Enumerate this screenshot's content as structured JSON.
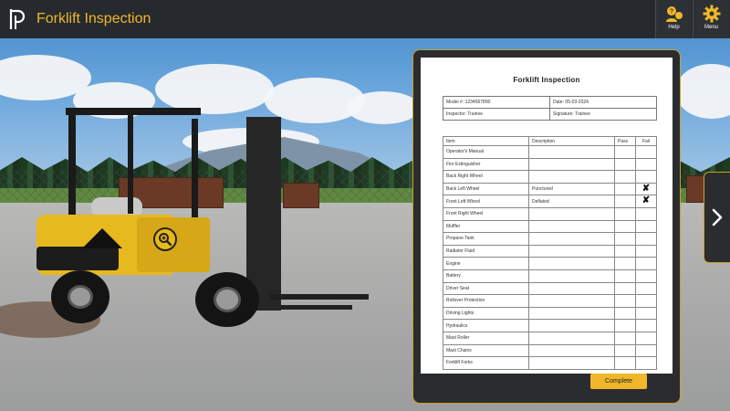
{
  "header": {
    "title": "Forklift Inspection",
    "help_label": "Help",
    "menu_label": "Menu"
  },
  "form": {
    "title": "Forklift Inspection",
    "model": "Model #: 1234567890",
    "date": "Date: 05-03-2024",
    "inspector": "Inspector: Trainee",
    "signature": "Signature: Trainee",
    "columns": [
      "Item",
      "Description",
      "Pass",
      "Fail"
    ],
    "rows": [
      {
        "item": "Operator's Manual",
        "description": "",
        "fail": ""
      },
      {
        "item": "Fire Extinguisher",
        "description": "",
        "fail": ""
      },
      {
        "item": "Back Right Wheel",
        "description": "",
        "fail": ""
      },
      {
        "item": "Back Left Wheel",
        "description": "Punctured",
        "fail": "✘"
      },
      {
        "item": "Front Left Wheel",
        "description": "Deflated",
        "fail": "✘"
      },
      {
        "item": "Front Right Wheel",
        "description": "",
        "fail": ""
      },
      {
        "item": "Muffler",
        "description": "",
        "fail": ""
      },
      {
        "item": "Propane Tank",
        "description": "",
        "fail": ""
      },
      {
        "item": "Radiator Fluid",
        "description": "",
        "fail": ""
      },
      {
        "item": "Engine",
        "description": "",
        "fail": ""
      },
      {
        "item": "Battery",
        "description": "",
        "fail": ""
      },
      {
        "item": "Driver Seat",
        "description": "",
        "fail": ""
      },
      {
        "item": "Rollover Protection",
        "description": "",
        "fail": ""
      },
      {
        "item": "Driving Lights",
        "description": "",
        "fail": ""
      },
      {
        "item": "Hydraulics",
        "description": "",
        "fail": ""
      },
      {
        "item": "Mast Roller",
        "description": "",
        "fail": ""
      },
      {
        "item": "Mast Chains",
        "description": "",
        "fail": ""
      },
      {
        "item": "Forklift Forks",
        "description": "",
        "fail": ""
      }
    ],
    "complete_label": "Complete"
  },
  "colors": {
    "accent": "#f0b72a",
    "topbar": "#262a2e",
    "panel": "#2a2c2f"
  }
}
